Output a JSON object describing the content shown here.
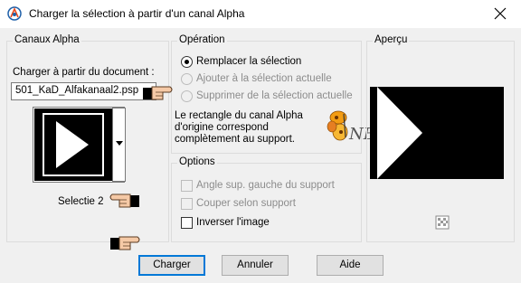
{
  "window": {
    "title": "Charger la sélection à partir d'un canal Alpha"
  },
  "left_panel": {
    "legend": "Canaux Alpha",
    "load_label": "Charger à partir du document :",
    "document_value": "501_KaD_Alfakanaal2.psp",
    "channel_name": "Selectie 2"
  },
  "operation": {
    "legend": "Opération",
    "options": [
      {
        "label": "Remplacer la sélection",
        "checked": true,
        "enabled": true
      },
      {
        "label": "Ajouter à la sélection actuelle",
        "checked": false,
        "enabled": false
      },
      {
        "label": "Supprimer de la sélection actuelle",
        "checked": false,
        "enabled": false
      }
    ],
    "info_lines": [
      "Le rectangle du canal Alpha",
      "d'origine correspond",
      "complètement au support."
    ]
  },
  "options": {
    "legend": "Options",
    "items": [
      {
        "label": "Angle sup. gauche du support",
        "checked": false,
        "enabled": false
      },
      {
        "label": "Couper selon support",
        "checked": false,
        "enabled": false
      },
      {
        "label": "Inverser l'image",
        "checked": false,
        "enabled": true
      }
    ]
  },
  "preview": {
    "legend": "Aperçu"
  },
  "buttons": {
    "load": "Charger",
    "cancel": "Annuler",
    "help": "Aide"
  },
  "watermark": {
    "text": "NB"
  },
  "colors": {
    "default_button_border": "#0078d7",
    "window_bg": "#f0f0f0"
  }
}
